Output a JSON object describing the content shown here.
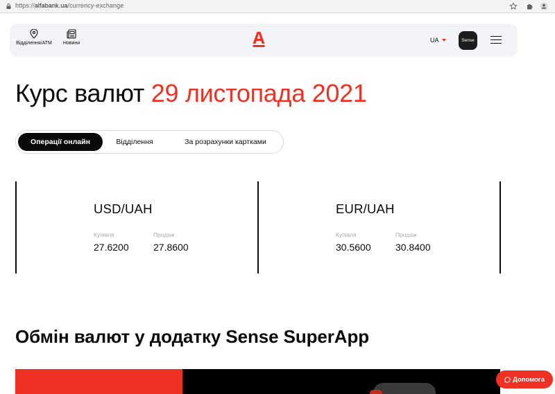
{
  "browser": {
    "url_prefix": "https://",
    "url_domain": "alfabank.ua",
    "url_path": "/currency-exchange"
  },
  "header": {
    "branches_label": "Відділення/ATM",
    "news_label": "Новини",
    "logo_letter": "А",
    "lang": "UA",
    "sense_label": "Sense"
  },
  "title": {
    "main": "Курс валют",
    "date": "29 листопада 2021"
  },
  "tabs": [
    {
      "label": "Операції онлайн",
      "active": true
    },
    {
      "label": "Відділення",
      "active": false
    },
    {
      "label": "За розрахунки картками",
      "active": false
    }
  ],
  "rates": [
    {
      "pair": "USD/UAH",
      "buy_label": "Купівля",
      "buy": "27.6200",
      "sell_label": "Продаж",
      "sell": "27.8600"
    },
    {
      "pair": "EUR/UAH",
      "buy_label": "Купівля",
      "buy": "30.5600",
      "sell_label": "Продаж",
      "sell": "30.8400"
    }
  ],
  "section": {
    "title": "Обмін валют у додатку Sense SuperApp"
  },
  "help": {
    "label": "Допомога"
  },
  "colors": {
    "accent": "#ef3124",
    "header_bg": "#f3f4f7",
    "text": "#0b0b0b",
    "muted": "#a9a9b0"
  }
}
